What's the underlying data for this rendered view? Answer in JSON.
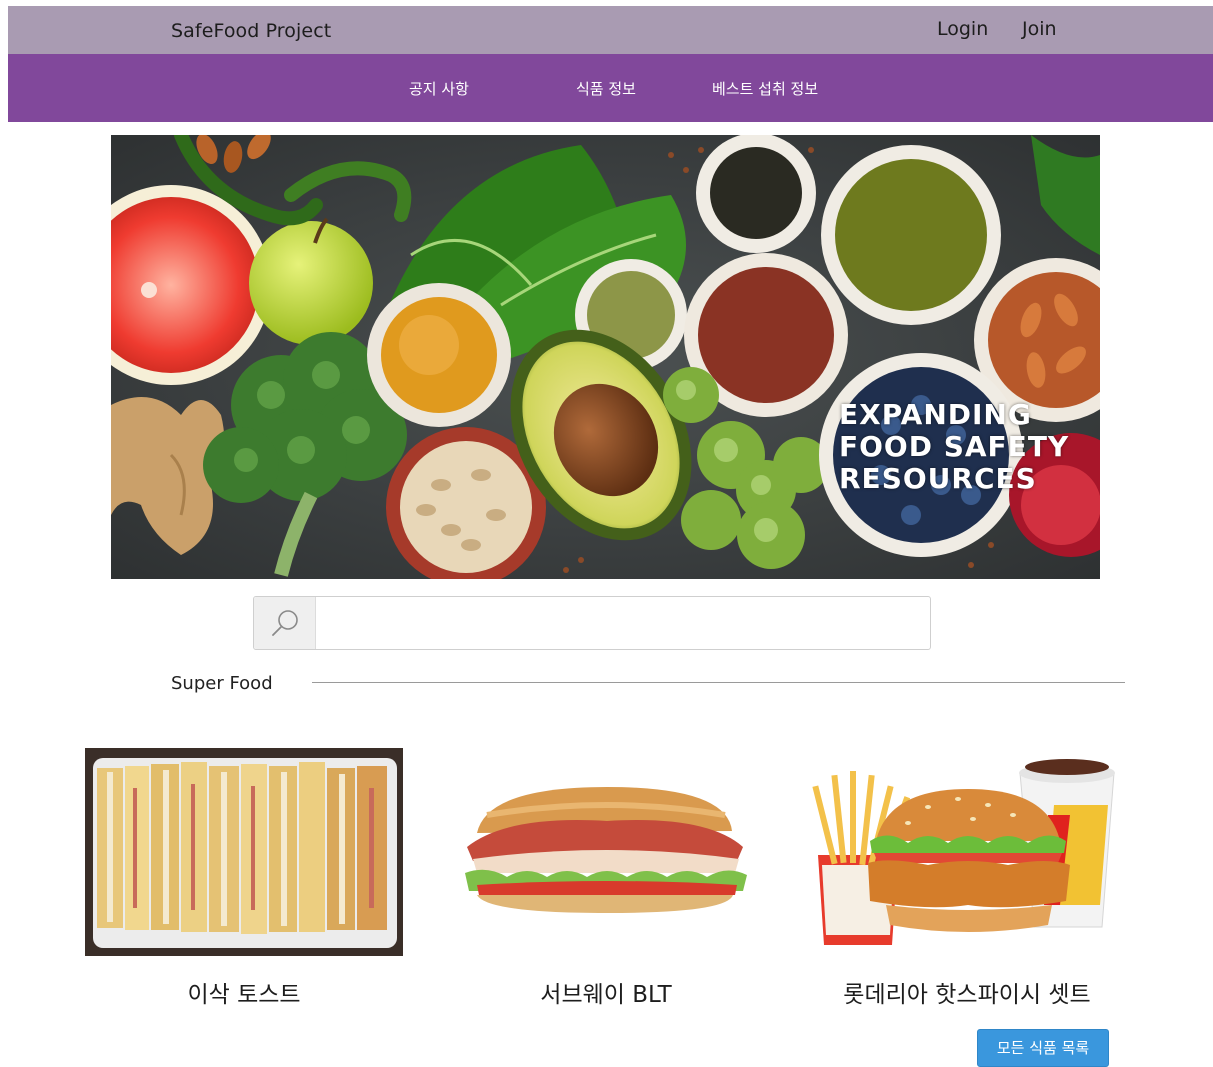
{
  "header": {
    "brand": "SafeFood Project",
    "login_label": "Login",
    "join_label": "Join"
  },
  "nav": {
    "items": [
      {
        "label": "공지 사항"
      },
      {
        "label": "식품 정보"
      },
      {
        "label": "베스트 섭취 정보"
      }
    ]
  },
  "hero": {
    "caption_lines": [
      "EXPANDING",
      "FOOD SAFETY",
      "RESOURCES"
    ]
  },
  "search": {
    "placeholder": "",
    "value": ""
  },
  "section": {
    "title": "Super Food"
  },
  "foods": [
    {
      "name": "이삭 토스트"
    },
    {
      "name": "서브웨이 BLT"
    },
    {
      "name": "롯데리아 핫스파이시 셋트"
    }
  ],
  "actions": {
    "all_foods_label": "모든 식품 목록"
  },
  "colors": {
    "topbar": "#a99bb2",
    "navbar": "#81489b",
    "button": "#3a97dd"
  }
}
